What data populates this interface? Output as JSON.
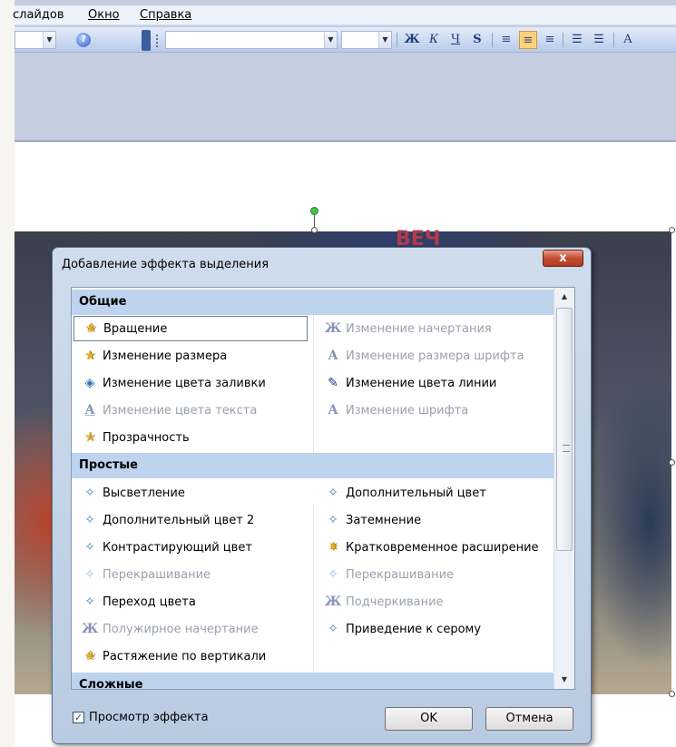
{
  "menu": {
    "items": [
      "слайдов",
      "Окно",
      "Справка"
    ]
  },
  "toolbar": {
    "format_buttons": [
      "Ж",
      "К",
      "Ч",
      "S"
    ],
    "help_glyph": "?"
  },
  "dialog": {
    "title": "Добавление эффекта выделения",
    "close_glyph": "x",
    "groups": [
      {
        "name": "Общие",
        "items": [
          {
            "label": "Вращение",
            "icon": "spin-star-icon",
            "enabled": true,
            "selected": true
          },
          {
            "label": "Изменение начертания",
            "icon": "font-style-icon",
            "enabled": false
          },
          {
            "label": "Изменение размера",
            "icon": "grow-star-icon",
            "enabled": true
          },
          {
            "label": "Изменение размера шрифта",
            "icon": "font-size-icon",
            "enabled": false
          },
          {
            "label": "Изменение цвета заливки",
            "icon": "fill-color-icon",
            "enabled": true
          },
          {
            "label": "Изменение цвета линии",
            "icon": "line-color-icon",
            "enabled": true
          },
          {
            "label": "Изменение цвета текста",
            "icon": "font-color-icon",
            "enabled": false
          },
          {
            "label": "Изменение шрифта",
            "icon": "font-change-icon",
            "enabled": false
          },
          {
            "label": "Прозрачность",
            "icon": "transparency-icon",
            "enabled": true
          }
        ]
      },
      {
        "name": "Простые",
        "items": [
          {
            "label": "Высветление",
            "icon": "lighten-icon",
            "enabled": true
          },
          {
            "label": "Дополнительный цвет",
            "icon": "complementary-color-icon",
            "enabled": true
          },
          {
            "label": "Дополнительный цвет 2",
            "icon": "complementary-color-2-icon",
            "enabled": true
          },
          {
            "label": "Затемнение",
            "icon": "darken-icon",
            "enabled": true
          },
          {
            "label": "Контрастирующий цвет",
            "icon": "contrast-color-icon",
            "enabled": true
          },
          {
            "label": "Кратковременное расширение",
            "icon": "flicker-expand-icon",
            "enabled": true
          },
          {
            "label": "Перекрашивание",
            "icon": "recolor-icon",
            "enabled": false
          },
          {
            "label": "Перекрашивание",
            "icon": "recolor-2-icon",
            "enabled": false
          },
          {
            "label": "Переход цвета",
            "icon": "color-blend-icon",
            "enabled": true
          },
          {
            "label": "Подчеркивание",
            "icon": "underline-icon",
            "enabled": false
          },
          {
            "label": "Полужирное начертание",
            "icon": "bold-icon",
            "enabled": false
          },
          {
            "label": "Приведение к серому",
            "icon": "desaturate-icon",
            "enabled": true
          },
          {
            "label": "Растяжение по вертикали",
            "icon": "vertical-stretch-icon",
            "enabled": true
          }
        ]
      },
      {
        "name": "Сложные",
        "items": []
      }
    ],
    "preview_label": "Просмотр эффекта",
    "preview_checked": true,
    "ok_label": "OK",
    "cancel_label": "Отмена"
  },
  "photo": {
    "banner_text": "ВЕЧ"
  }
}
